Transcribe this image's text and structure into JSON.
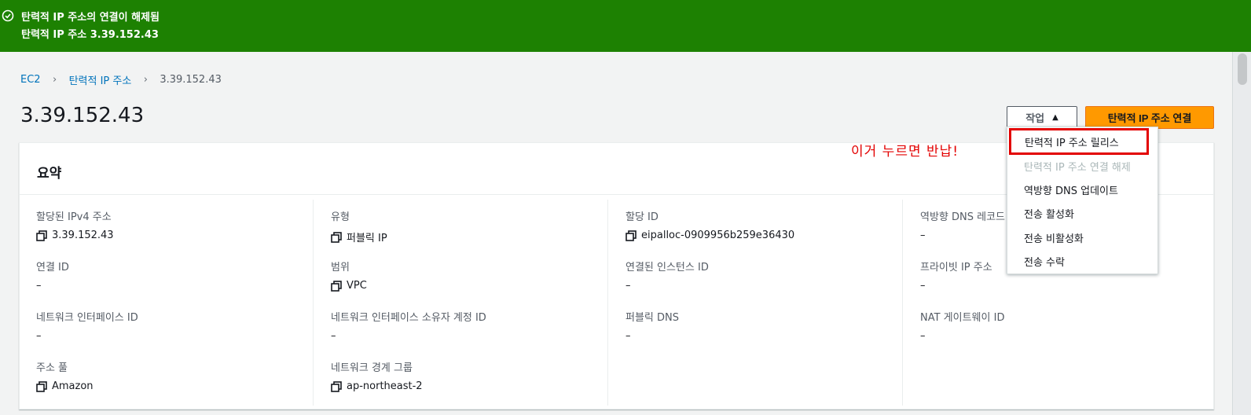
{
  "flash": {
    "title": "탄력적 IP 주소의 연결이 해제됨",
    "message": "탄력적 IP 주소 3.39.152.43",
    "color": "#1d8102"
  },
  "breadcrumb": {
    "items": [
      "EC2",
      "탄력적 IP 주소",
      "3.39.152.43"
    ]
  },
  "page_title": "3.39.152.43",
  "toolbar": {
    "actions_label": "작업",
    "primary_label": "탄력적 IP 주소 연결",
    "primary_color": "#ff9900"
  },
  "actions_menu": {
    "items": [
      {
        "label": "탄력적 IP 주소 릴리스",
        "disabled": false,
        "highlighted": true
      },
      {
        "label": "탄력적 IP 주소 연결 해제",
        "disabled": true
      },
      {
        "label": "역방향 DNS 업데이트",
        "disabled": false
      },
      {
        "label": "전송 활성화",
        "disabled": false
      },
      {
        "label": "전송 비활성화",
        "disabled": false
      },
      {
        "label": "전송 수락",
        "disabled": false
      }
    ]
  },
  "annotation": "이거 누르면 반납!",
  "summary": {
    "title": "요약",
    "fields": {
      "allocated_ipv4": {
        "label": "할당된 IPv4 주소",
        "value": "3.39.152.43",
        "copy": true
      },
      "type": {
        "label": "유형",
        "value": "퍼블릭 IP",
        "copy": true
      },
      "allocation_id": {
        "label": "할당 ID",
        "value": "eipalloc-0909956b259e36430",
        "copy": true
      },
      "reverse_dns": {
        "label": "역방향 DNS 레코드",
        "value": "–"
      },
      "association_id": {
        "label": "연결 ID",
        "value": "–"
      },
      "scope": {
        "label": "범위",
        "value": "VPC",
        "copy": true
      },
      "associated_instance": {
        "label": "연결된 인스턴스 ID",
        "value": "–"
      },
      "private_ip": {
        "label": "프라이빗 IP 주소",
        "value": "–"
      },
      "network_interface": {
        "label": "네트워크 인터페이스 ID",
        "value": "–"
      },
      "ni_owner": {
        "label": "네트워크 인터페이스 소유자 계정 ID",
        "value": "–"
      },
      "public_dns": {
        "label": "퍼블릭 DNS",
        "value": "–"
      },
      "nat_gateway": {
        "label": "NAT 게이트웨이 ID",
        "value": "–"
      },
      "address_pool": {
        "label": "주소 풀",
        "value": "Amazon",
        "copy": true
      },
      "network_border_group": {
        "label": "네트워크 경계 그룹",
        "value": "ap-northeast-2",
        "copy": true
      }
    }
  }
}
